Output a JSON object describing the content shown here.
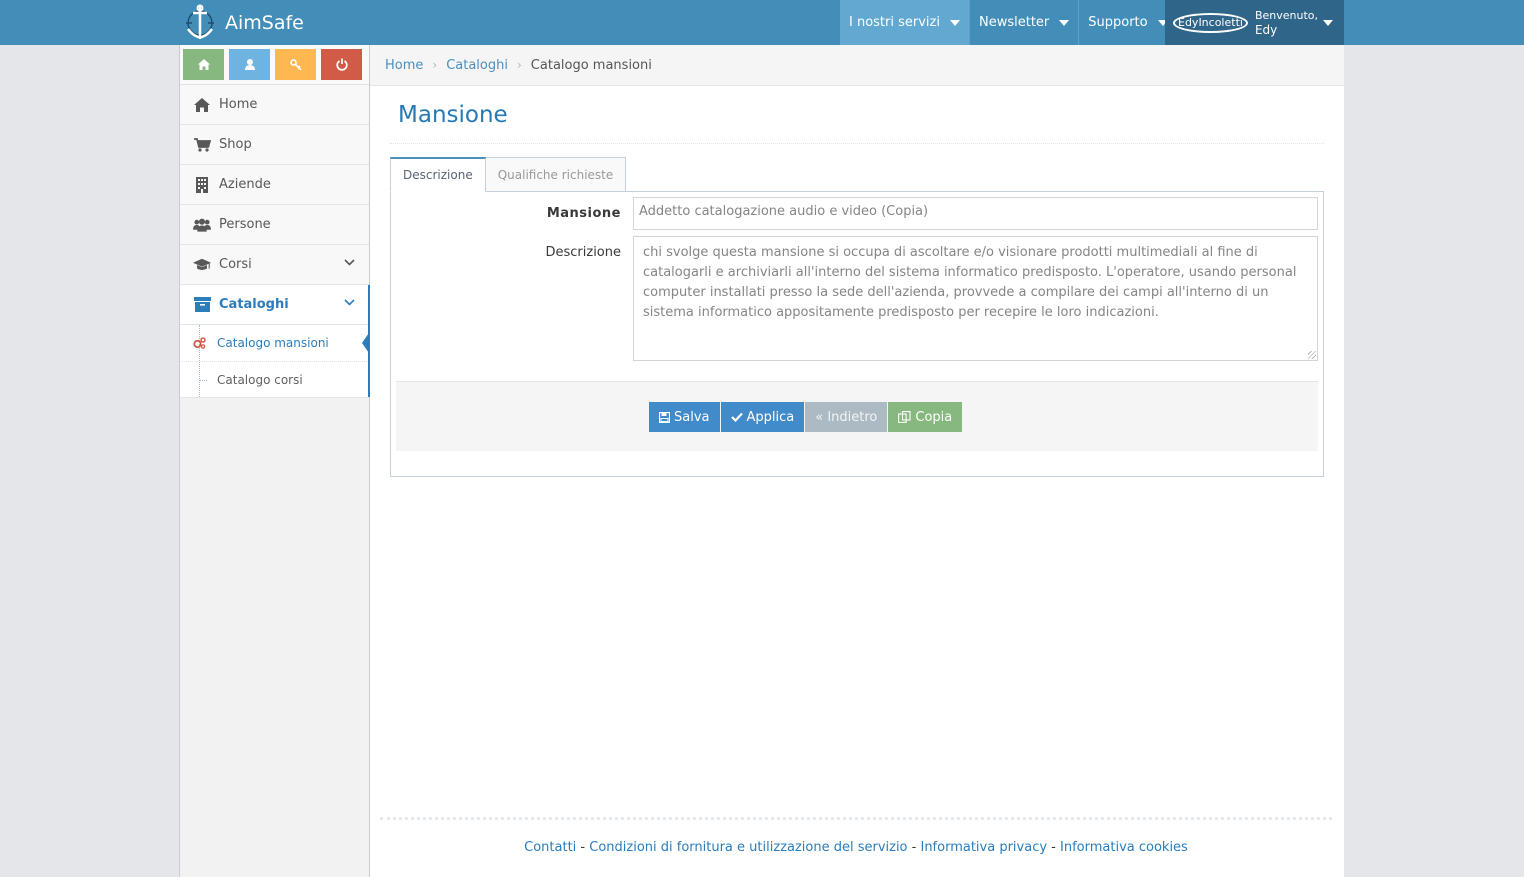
{
  "navbar": {
    "brand": "AimSafe",
    "items": [
      {
        "label": "I nostri servizi"
      },
      {
        "label": "Newsletter"
      },
      {
        "label": "Supporto"
      }
    ],
    "user": {
      "avatar_text": "EdyIncoletti",
      "welcome": "Benvenuto,",
      "name": "Edy"
    },
    "colors": {
      "bar": "#438eb9",
      "highlight": "#62a8d1",
      "user_bg": "#2e6589"
    }
  },
  "sidebar": {
    "shortcuts": [
      {
        "icon": "home-icon",
        "color": "#87b87f"
      },
      {
        "icon": "user-icon",
        "color": "#6fb3e0"
      },
      {
        "icon": "key-icon",
        "color": "#ffb752"
      },
      {
        "icon": "power-icon",
        "color": "#d15b47"
      }
    ],
    "items": [
      {
        "label": "Home",
        "icon": "home-icon"
      },
      {
        "label": "Shop",
        "icon": "cart-icon"
      },
      {
        "label": "Aziende",
        "icon": "building-icon"
      },
      {
        "label": "Persone",
        "icon": "users-icon"
      },
      {
        "label": "Corsi",
        "icon": "graduation-cap-icon"
      },
      {
        "label": "Cataloghi",
        "icon": "archive-icon"
      }
    ],
    "subitems": [
      {
        "label": "Catalogo mansioni",
        "icon": "cogs-icon"
      },
      {
        "label": "Catalogo corsi"
      }
    ]
  },
  "breadcrumbs": {
    "items": [
      "Home",
      "Cataloghi"
    ],
    "current": "Catalogo mansioni"
  },
  "page": {
    "title": "Mansione",
    "tabs": [
      "Descrizione",
      "Qualifiche richieste"
    ],
    "form": {
      "mansione_label": "Mansione",
      "mansione_value": "Addetto catalogazione audio e video (Copia)",
      "descrizione_label": "Descrizione",
      "descrizione_value": "chi svolge questa mansione si occupa di ascoltare e/o visionare prodotti multimediali al fine di catalogarli e archiviarli all'interno del sistema informatico predisposto. L'operatore, usando personal computer installati presso la sede dell'azienda, provvede a compilare dei campi all'interno di un sistema informatico appositamente predisposto per recepire le loro indicazioni."
    },
    "buttons": {
      "salva": "Salva",
      "applica": "Applica",
      "indietro": "« Indietro",
      "copia": "Copia"
    }
  },
  "footer": {
    "links": [
      "Contatti",
      "Condizioni di fornitura e utilizzazione del servizio",
      "Informativa privacy",
      "Informativa cookies"
    ],
    "separator": " - "
  }
}
